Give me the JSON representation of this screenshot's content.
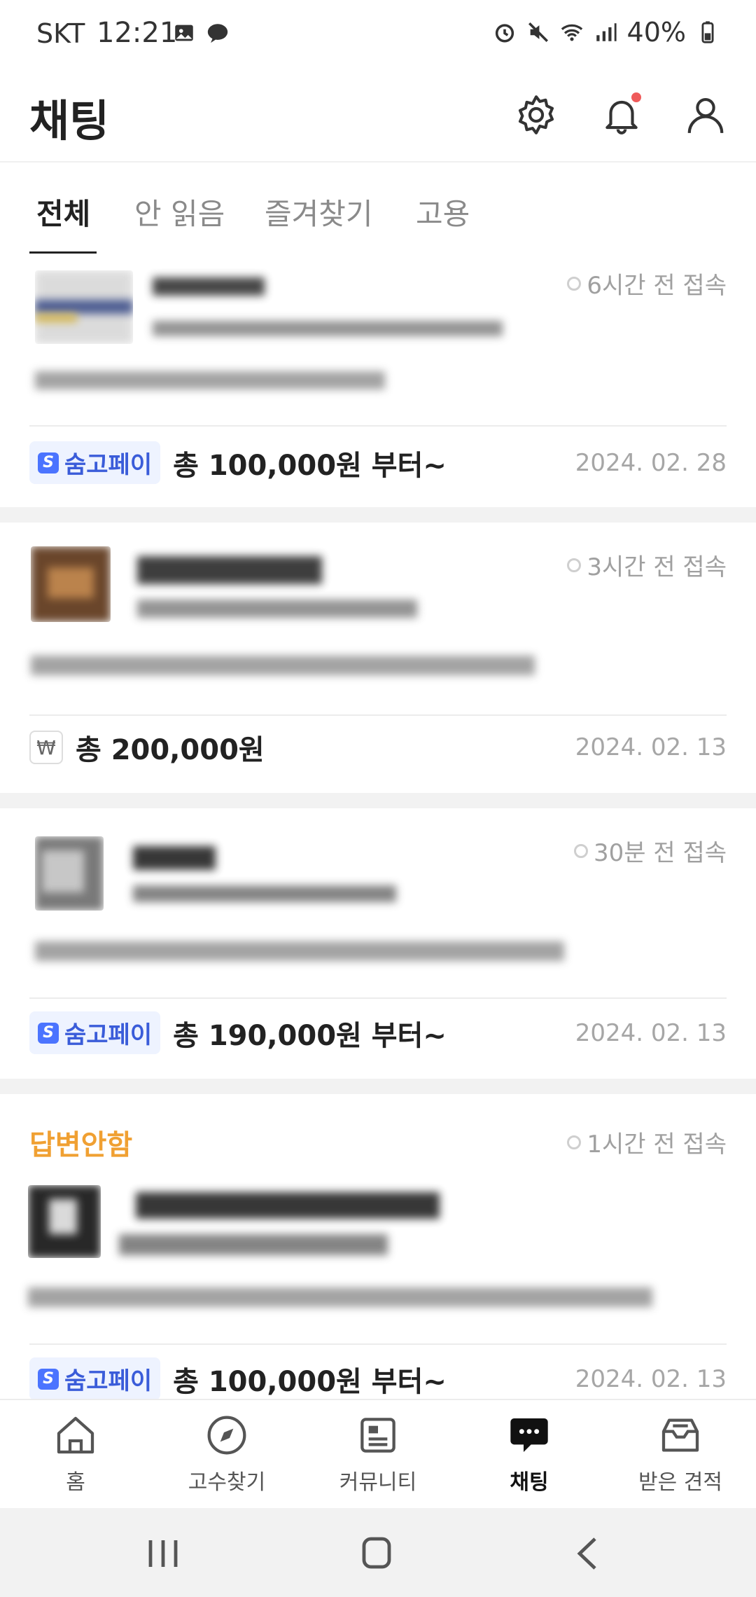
{
  "status_bar": {
    "carrier": "SKT",
    "time": "12:21",
    "battery": "40%"
  },
  "header": {
    "title": "채팅",
    "icons": [
      "gear-icon",
      "bell-icon",
      "profile-icon"
    ],
    "notification_dot_color": "#ef5a5a"
  },
  "tabs": [
    {
      "label": "전체",
      "active": true
    },
    {
      "label": "안 읽음",
      "active": false
    },
    {
      "label": "즐겨찾기",
      "active": false
    },
    {
      "label": "고용",
      "active": false
    }
  ],
  "chats": [
    {
      "status": "6시간 전 접속",
      "badge": "숨고페이",
      "price": "총 100,000원 부터~",
      "date": "2024. 02. 28"
    },
    {
      "status": "3시간 전 접속",
      "badge_icon": "₩",
      "price": "총 200,000원",
      "date": "2024. 02. 13"
    },
    {
      "status": "30분 전 접속",
      "badge": "숨고페이",
      "price": "총 190,000원 부터~",
      "date": "2024. 02. 13"
    },
    {
      "label": "답변안함",
      "status": "1시간 전 접속",
      "badge": "숨고페이",
      "price": "총 100,000원 부터~",
      "date": "2024. 02. 13"
    }
  ],
  "bottom_nav": [
    {
      "label": "홈",
      "icon": "home-icon",
      "active": false
    },
    {
      "label": "고수찾기",
      "icon": "compass-icon",
      "active": false
    },
    {
      "label": "커뮤니티",
      "icon": "community-icon",
      "active": false
    },
    {
      "label": "채팅",
      "icon": "chat-icon",
      "active": true
    },
    {
      "label": "받은 견적",
      "icon": "inbox-icon",
      "active": false
    }
  ],
  "colors": {
    "accent_pay": "#4b74ff",
    "unanswered": "#f0a032",
    "muted": "#a6a6a6"
  }
}
